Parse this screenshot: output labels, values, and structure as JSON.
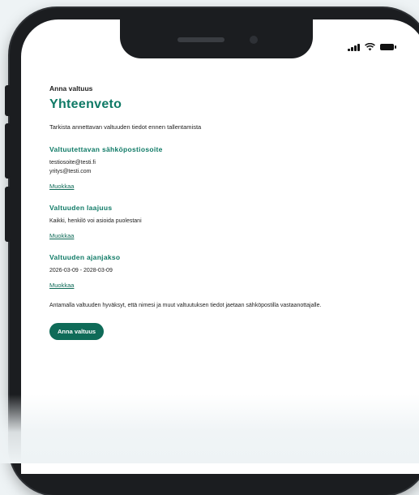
{
  "status_bar": {
    "signal_icon": "cellular-signal-icon",
    "wifi_icon": "wifi-icon",
    "battery_icon": "battery-icon"
  },
  "page": {
    "eyebrow": "Anna valtuus",
    "title": "Yhteenveto",
    "intro": "Tarkista annettavan valtuuden tiedot ennen tallentamista"
  },
  "sections": {
    "email": {
      "heading": "Valtuutettavan sähköpostiosoite",
      "lines": [
        "testiosoite@testi.fi",
        "yritys@testi.com"
      ],
      "edit_label": "Muokkaa"
    },
    "scope": {
      "heading": "Valtuuden laajuus",
      "lines": [
        "Kaikki, henkilö voi asioida puolestani"
      ],
      "edit_label": "Muokkaa"
    },
    "period": {
      "heading": "Valtuuden ajanjakso",
      "lines": [
        "2026-03-09 - 2028-03-09"
      ],
      "edit_label": "Muokkaa"
    }
  },
  "consent_text": "Antamalla valtuuden hyväksyt, että nimesi ja muut valtuutuksen tiedot jaetaan sähköpostilla vastaanottajalle.",
  "submit_label": "Anna valtuus",
  "colors": {
    "accent": "#0f7a66",
    "button": "#0f6b58",
    "frame": "#1b1d20",
    "background": "#eef3f5"
  }
}
